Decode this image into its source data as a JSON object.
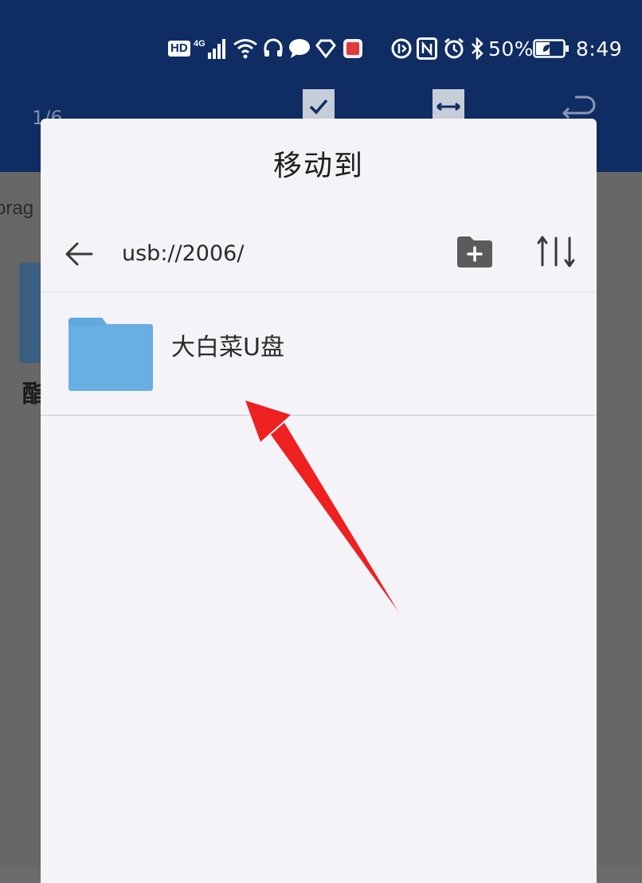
{
  "status_bar": {
    "hd": "HD",
    "network": "4G",
    "battery_percent": "50%",
    "time": "8:49",
    "battery_level": 0.5
  },
  "background": {
    "counter": "1/6",
    "storage_label": "orag",
    "item_char": "酯"
  },
  "dialog": {
    "title": "移动到",
    "path": "usb://2006/",
    "items": [
      {
        "name": "大白菜U盘",
        "type": "folder"
      }
    ]
  },
  "colors": {
    "header": "#0f2d63",
    "folder": "#62a8df",
    "arrow": "#ee2020",
    "dialog_bg": "#f4f3f8"
  },
  "icons": {
    "back": "arrow-left-icon",
    "new_folder": "new-folder-icon",
    "sort": "sort-icon",
    "folder": "folder-icon"
  }
}
